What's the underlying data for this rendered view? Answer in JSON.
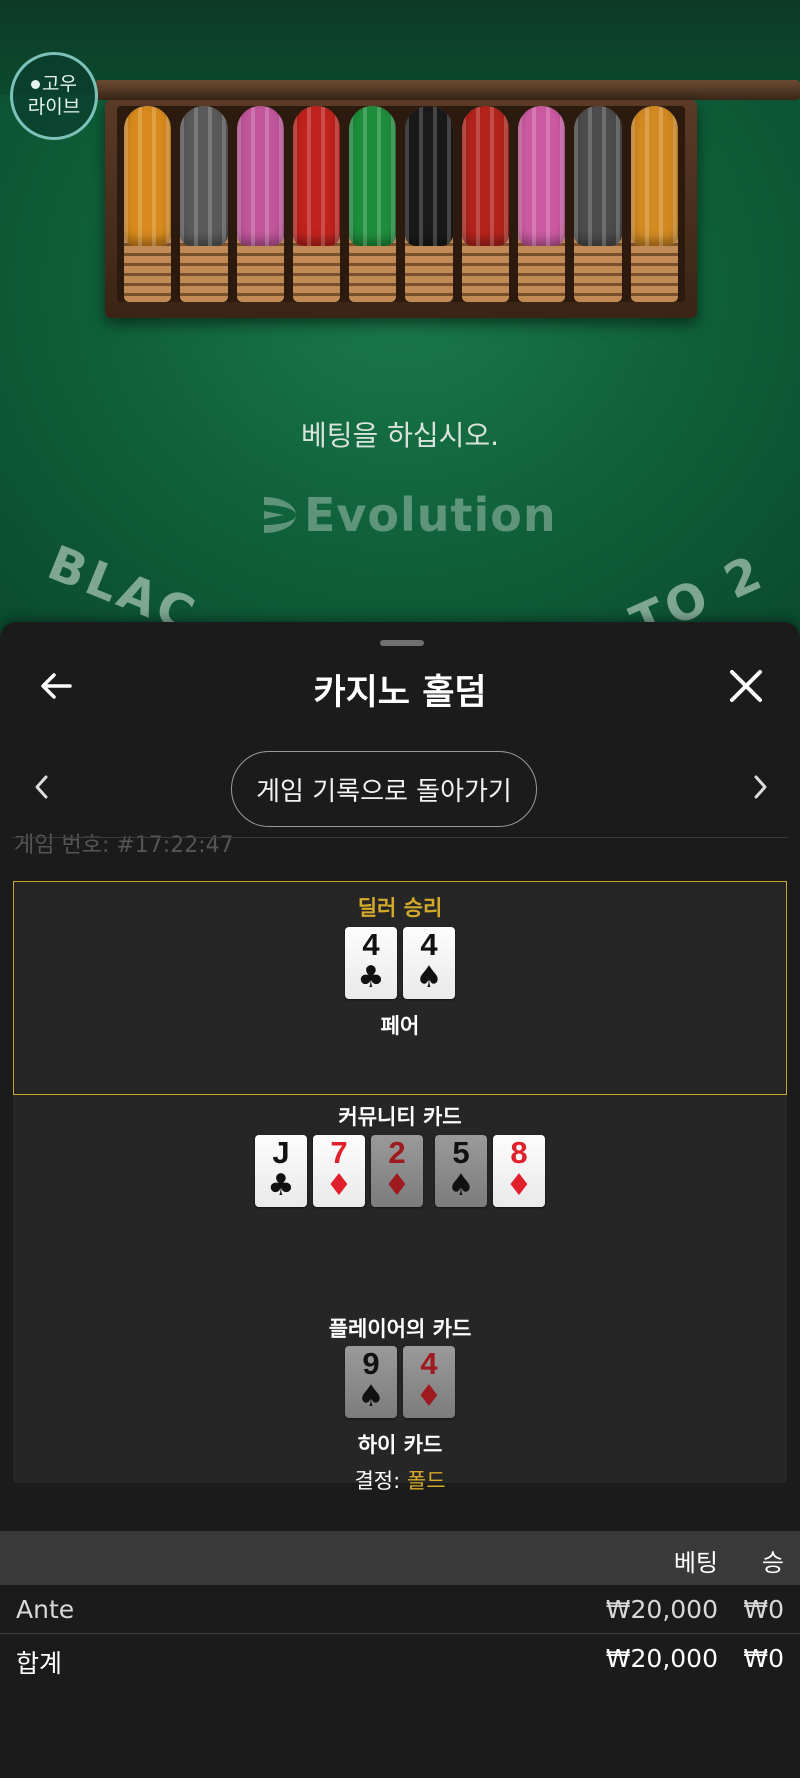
{
  "table": {
    "brand_badge": {
      "line1": "고우",
      "line2": "라이브"
    },
    "bet_prompt": "베팅을 하십시오.",
    "provider_logo": "Evolution",
    "arc_text_left": "BLAC",
    "arc_text_right": "TO 2",
    "chip_colors": [
      "#d88a1c",
      "#5a5a5a",
      "#c2569c",
      "#c0221d",
      "#1e8e3c",
      "#1a1a1a",
      "#b3231c",
      "#cc5aa3",
      "#4c4c4c",
      "#d38a22"
    ]
  },
  "sheet": {
    "title": "카지노 홀덤",
    "back_icon": "arrow-left-icon",
    "close_icon": "close-icon",
    "back_to_history_label": "게임 기록으로 돌아가기",
    "game_number": "게임 번호: #17:22:47",
    "dealer": {
      "status": "딜러 승리",
      "hand": "페어",
      "cards": [
        {
          "rank": "4",
          "suit": "♣",
          "color": "black",
          "dim": false
        },
        {
          "rank": "4",
          "suit": "♠",
          "color": "black",
          "dim": false
        }
      ]
    },
    "community": {
      "title": "커뮤니티 카드",
      "cards": [
        {
          "rank": "J",
          "suit": "♣",
          "color": "black",
          "dim": false
        },
        {
          "rank": "7",
          "suit": "♦",
          "color": "red",
          "dim": false
        },
        {
          "rank": "2",
          "suit": "♦",
          "color": "red",
          "dim": true
        },
        {
          "rank": "5",
          "suit": "♠",
          "color": "black",
          "dim": true
        },
        {
          "rank": "8",
          "suit": "♦",
          "color": "red",
          "dim": false
        }
      ]
    },
    "player": {
      "title": "플레이어의 카드",
      "hand": "하이 카드",
      "decision_label": "결정:",
      "decision_value": "폴드",
      "cards": [
        {
          "rank": "9",
          "suit": "♠",
          "color": "black",
          "dim": true
        },
        {
          "rank": "4",
          "suit": "♦",
          "color": "red",
          "dim": true
        }
      ]
    },
    "bets": {
      "col_bet": "베팅",
      "col_win": "승",
      "rows": [
        {
          "label": "Ante",
          "bet": "₩20,000",
          "win": "₩0"
        },
        {
          "label": "합계",
          "bet": "₩20,000",
          "win": "₩0"
        }
      ]
    }
  }
}
